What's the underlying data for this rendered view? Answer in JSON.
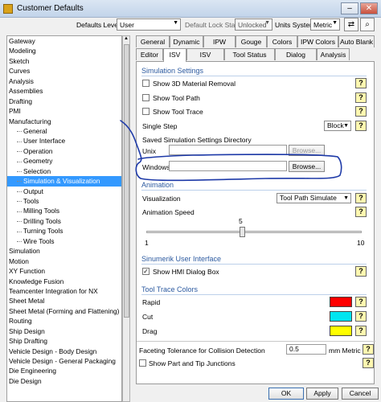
{
  "window": {
    "title": "Customer Defaults",
    "minimize": "–",
    "close": "✕"
  },
  "toolbar": {
    "defaults_level_label": "Defaults Level",
    "defaults_level_value": "User",
    "default_lock_state_label": "Default Lock State",
    "lock_state_value": "Unlocked",
    "units_system_label": "Units System",
    "units_system_value": "Metric",
    "icons": [
      "import-export-icon",
      "find-icon"
    ]
  },
  "tree": {
    "items": [
      {
        "label": "Gateway",
        "child": false
      },
      {
        "label": "Modeling",
        "child": false
      },
      {
        "label": "Sketch",
        "child": false
      },
      {
        "label": "Curves",
        "child": false
      },
      {
        "label": "Analysis",
        "child": false
      },
      {
        "label": "Assemblies",
        "child": false
      },
      {
        "label": "Drafting",
        "child": false
      },
      {
        "label": "PMI",
        "child": false
      },
      {
        "label": "Manufacturing",
        "child": false
      },
      {
        "label": "General",
        "child": true
      },
      {
        "label": "User Interface",
        "child": true
      },
      {
        "label": "Operation",
        "child": true
      },
      {
        "label": "Geometry",
        "child": true
      },
      {
        "label": "Selection",
        "child": true
      },
      {
        "label": "Simulation & Visualization",
        "child": true,
        "selected": true
      },
      {
        "label": "Output",
        "child": true
      },
      {
        "label": "Tools",
        "child": true
      },
      {
        "label": "Milling Tools",
        "child": true
      },
      {
        "label": "Drilling Tools",
        "child": true
      },
      {
        "label": "Turning Tools",
        "child": true
      },
      {
        "label": "Wire Tools",
        "child": true
      },
      {
        "label": "Simulation",
        "child": false
      },
      {
        "label": "Motion",
        "child": false
      },
      {
        "label": "XY Function",
        "child": false
      },
      {
        "label": "Knowledge Fusion",
        "child": false
      },
      {
        "label": "Teamcenter Integration for NX",
        "child": false
      },
      {
        "label": "Sheet Metal",
        "child": false
      },
      {
        "label": "Sheet Metal (Forming and Flattening)",
        "child": false
      },
      {
        "label": "Routing",
        "child": false
      },
      {
        "label": "Ship Design",
        "child": false
      },
      {
        "label": "Ship Drafting",
        "child": false
      },
      {
        "label": "Vehicle Design - Body Design",
        "child": false
      },
      {
        "label": "Vehicle Design - General Packaging",
        "child": false
      },
      {
        "label": "Die Engineering",
        "child": false
      },
      {
        "label": "Die Design",
        "child": false
      }
    ]
  },
  "tabs_top": [
    "General",
    "Dynamic",
    "IPW",
    "Gouge",
    "Colors",
    "IPW Colors",
    "Auto Blank"
  ],
  "tabs_bottom": [
    "Editor",
    "ISV",
    "ISV Options",
    "Tool Status Display",
    "Dialog Boxes",
    "Analysis"
  ],
  "simulation_settings": {
    "title": "Simulation Settings",
    "show_3d_removal": "Show 3D Material Removal",
    "show_tool_path": "Show Tool Path",
    "show_tool_trace": "Show Tool Trace",
    "single_step_label": "Single Step",
    "single_step_value": "Block",
    "saved_dir_label": "Saved Simulation Settings Directory",
    "unix_label": "Unix",
    "windows_label": "Windows",
    "browse_label": "Browse...",
    "help_label": "?"
  },
  "animation": {
    "title": "Animation",
    "visualization_label": "Visualization",
    "visualization_value": "Tool Path Simulate",
    "speed_label": "Animation Speed",
    "speed_value": "5",
    "speed_min": "1",
    "speed_max": "10",
    "speed_fraction": 0.444
  },
  "sinumerik": {
    "title": "Sinumerik User Interface",
    "show_hmi": "Show HMI Dialog Box",
    "show_hmi_checked": "✓"
  },
  "tool_trace_colors": {
    "title": "Tool Trace Colors",
    "rapid_label": "Rapid",
    "rapid_color": "#ff0000",
    "cut_label": "Cut",
    "cut_color": "#00e5f0",
    "drag_label": "Drag",
    "drag_color": "#ffff00"
  },
  "faceting": {
    "label": "Faceting Tolerance for Collision Detection",
    "value": "0.5",
    "unit": "mm Metric",
    "show_part_tip": "Show Part and Tip Junctions"
  },
  "buttons": {
    "ok": "OK",
    "apply": "Apply",
    "cancel": "Cancel"
  },
  "annotation_color": "#1e3aa8"
}
